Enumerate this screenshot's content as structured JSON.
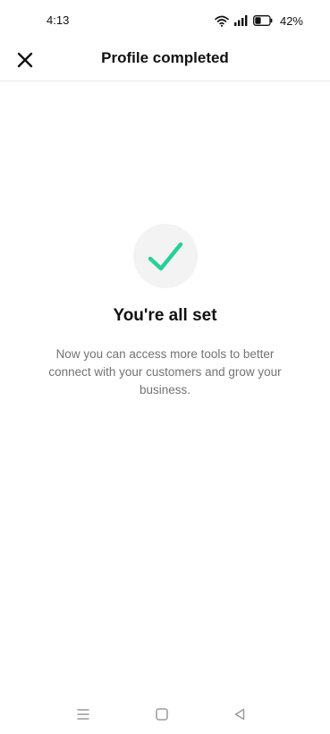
{
  "status_bar": {
    "time": "4:13",
    "battery_percent": "42%",
    "battery_level": 0.42,
    "icons": [
      "wifi-icon",
      "signal-icon",
      "battery-icon"
    ]
  },
  "header": {
    "title": "Profile completed",
    "close_icon": "close-icon"
  },
  "main": {
    "icon": "checkmark-icon",
    "title": "You're all set",
    "message": "Now you can access more tools to better connect with your customers and grow your business."
  },
  "nav_bar": {
    "icons": [
      "menu-icon",
      "home-icon",
      "back-icon"
    ]
  },
  "colors": {
    "accent": "#25d09b",
    "icon_circle_bg": "#f3f3f3",
    "text_primary": "#111111",
    "text_secondary": "#737373",
    "divider": "#e3e3e3",
    "nav_icon": "#9a9a9a"
  }
}
